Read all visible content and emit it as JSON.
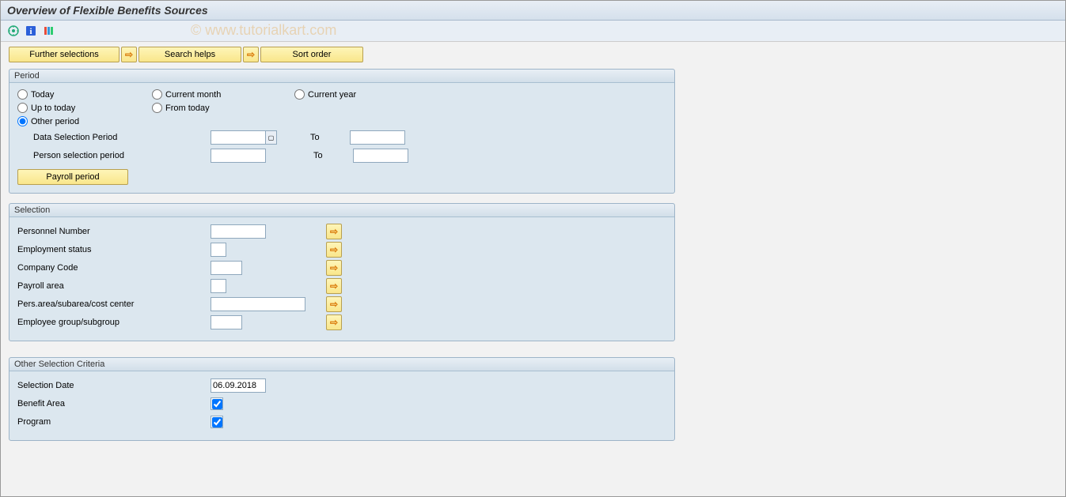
{
  "title": "Overview of Flexible Benefits Sources",
  "watermark": "© www.tutorialkart.com",
  "buttons": {
    "further_selections": "Further selections",
    "search_helps": "Search helps",
    "sort_order": "Sort order",
    "payroll_period": "Payroll period"
  },
  "period": {
    "title": "Period",
    "radios": {
      "today": "Today",
      "current_month": "Current month",
      "current_year": "Current year",
      "up_to_today": "Up to today",
      "from_today": "From today",
      "other_period": "Other period"
    },
    "labels": {
      "data_selection_period": "Data Selection Period",
      "person_selection_period": "Person selection period",
      "to": "To"
    },
    "values": {
      "data_from": "",
      "data_to": "",
      "person_from": "",
      "person_to": ""
    }
  },
  "selection": {
    "title": "Selection",
    "labels": {
      "personnel_number": "Personnel Number",
      "employment_status": "Employment status",
      "company_code": "Company Code",
      "payroll_area": "Payroll area",
      "pers_area": "Pers.area/subarea/cost center",
      "employee_group": "Employee group/subgroup"
    },
    "values": {
      "personnel_number": "",
      "employment_status": "",
      "company_code": "",
      "payroll_area": "",
      "pers_area": "",
      "employee_group": ""
    }
  },
  "other_criteria": {
    "title": "Other Selection Criteria",
    "labels": {
      "selection_date": "Selection Date",
      "benefit_area": "Benefit Area",
      "program": "Program"
    },
    "values": {
      "selection_date": "06.09.2018"
    }
  }
}
